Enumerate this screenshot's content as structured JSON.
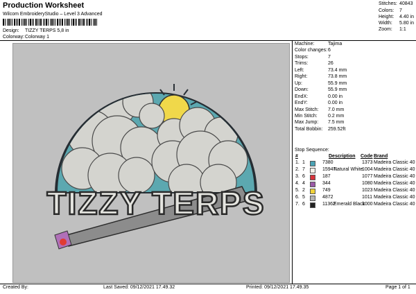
{
  "header": {
    "title": "Production Worksheet",
    "software": "Wilcom EmbroideryStudio – Level 3 Advanced",
    "design_label": "Design:",
    "design_value": "TIZZY TERPS 5,8 in",
    "colorway_label": "Colorway:",
    "colorway_value": "Colorway 1"
  },
  "summary": [
    {
      "label": "Stitches:",
      "value": "40843"
    },
    {
      "label": "Colors:",
      "value": "7"
    },
    {
      "label": "Height:",
      "value": "4.40 in"
    },
    {
      "label": "Width:",
      "value": "5.80 in"
    },
    {
      "label": "Zoom:",
      "value": "1:1"
    }
  ],
  "details": [
    {
      "label": "Machine:",
      "value": "Tajima"
    },
    {
      "label": "Color changes:",
      "value": "6"
    },
    {
      "label": "Stops:",
      "value": "7"
    },
    {
      "label": "Trims:",
      "value": "26"
    },
    {
      "label": "Left:",
      "value": "73.4 mm"
    },
    {
      "label": "Right:",
      "value": "73.8 mm"
    },
    {
      "label": "Up:",
      "value": "55.9 mm"
    },
    {
      "label": "Down:",
      "value": "55.9 mm"
    },
    {
      "label": "EndX:",
      "value": "0.00 in"
    },
    {
      "label": "EndY:",
      "value": "0.00 in"
    },
    {
      "label": "Max Stitch:",
      "value": "7.0 mm"
    },
    {
      "label": "Min Stitch:",
      "value": "0.2 mm"
    },
    {
      "label": "Max Jump:",
      "value": "7.5 mm"
    },
    {
      "label": "Total Bobbin:",
      "value": "259.52ft"
    }
  ],
  "stop_sequence": {
    "title": "Stop Sequence:",
    "headers": {
      "n": "#",
      "description": "Description",
      "code": "Code",
      "brand": "Brand"
    },
    "rows": [
      {
        "seq": "1.",
        "stop": "1",
        "color": "#4aa3b5",
        "number": "7380",
        "desc": "",
        "code": "1373",
        "brand": "Madeira Classic 40"
      },
      {
        "seq": "2.",
        "stop": "7",
        "color": "#f4f2ea",
        "number": "15947",
        "desc": "Natural White",
        "code": "1004",
        "brand": "Madeira Classic 40"
      },
      {
        "seq": "3.",
        "stop": "6",
        "color": "#d8343b",
        "number": "187",
        "desc": "",
        "code": "1077",
        "brand": "Madeira Classic 40"
      },
      {
        "seq": "4.",
        "stop": "4",
        "color": "#9a5aa6",
        "number": "344",
        "desc": "",
        "code": "1080",
        "brand": "Madeira Classic 40"
      },
      {
        "seq": "5.",
        "stop": "2",
        "color": "#f0d23a",
        "number": "749",
        "desc": "",
        "code": "1023",
        "brand": "Madeira Classic 40"
      },
      {
        "seq": "6.",
        "stop": "5",
        "color": "#b3b3b3",
        "number": "4872",
        "desc": "",
        "code": "1011",
        "brand": "Madeira Classic 40"
      },
      {
        "seq": "7.",
        "stop": "6",
        "color": "#222222",
        "number": "11362",
        "desc": "Emerald Black",
        "code": "1000",
        "brand": "Madeira Classic 40"
      }
    ]
  },
  "preview": {
    "logo_text": "TIZZY TERPS"
  },
  "footer": {
    "created_by": "Created By:",
    "last_saved": "Last Saved: 09/12/2021 17.49.32",
    "printed": "Printed: 09/12/2021 17.49.35",
    "page": "Page 1 of 1"
  }
}
